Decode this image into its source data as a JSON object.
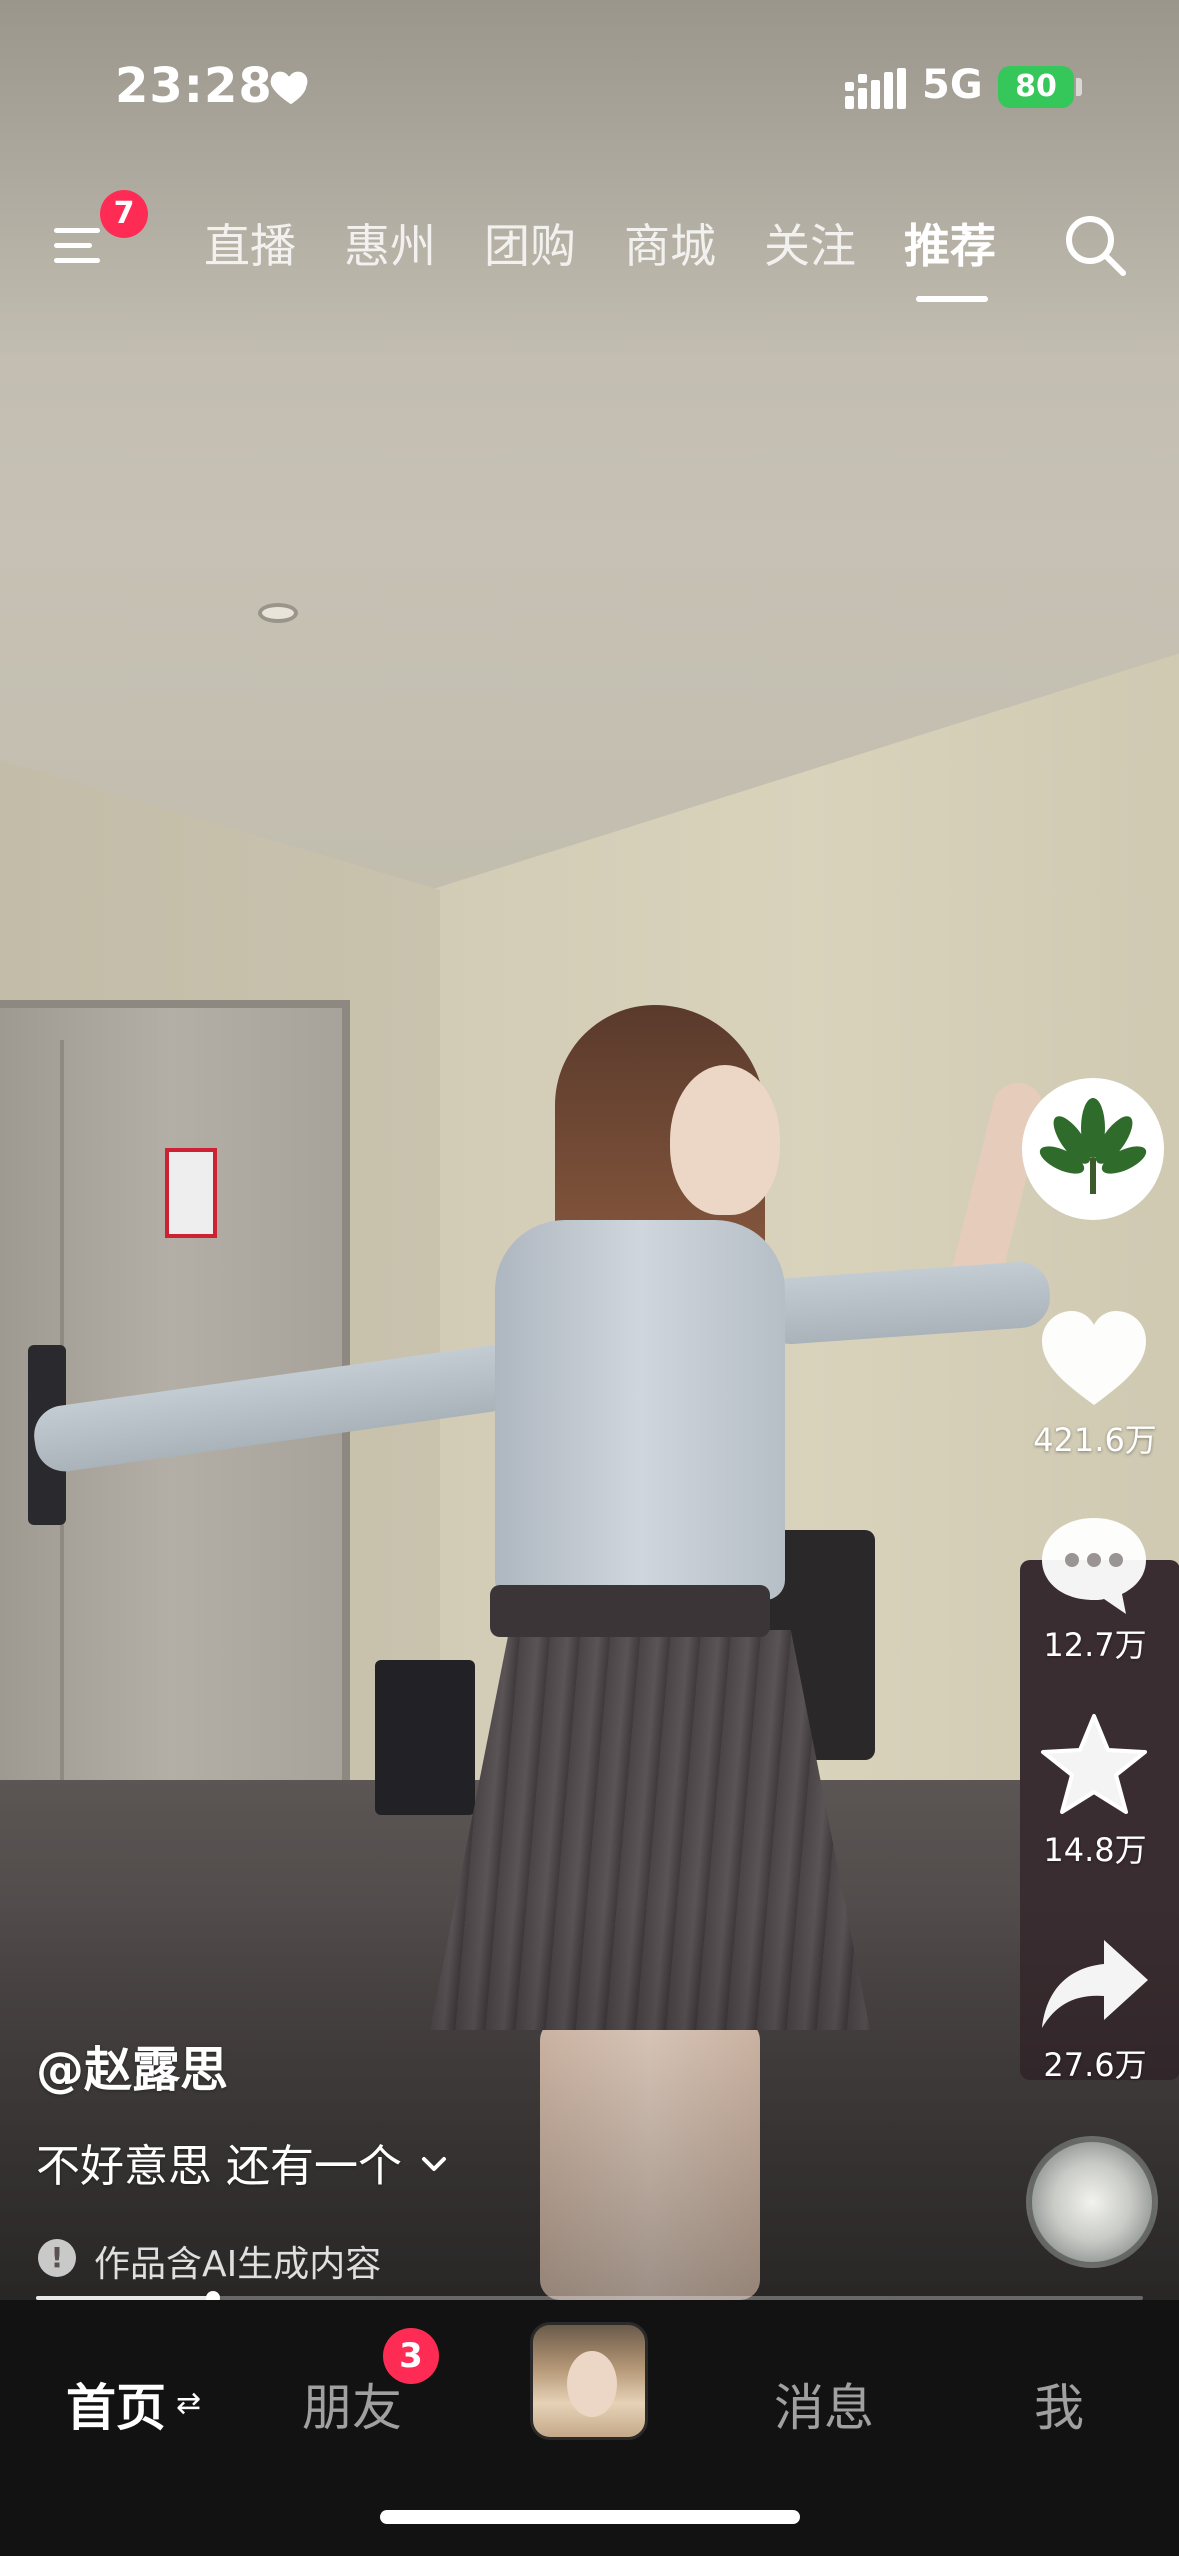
{
  "status_bar": {
    "time": "23:28",
    "network": "5G",
    "battery": "80"
  },
  "top_nav": {
    "menu_badge": "7",
    "tabs": [
      {
        "label": "直播",
        "active": false
      },
      {
        "label": "惠州",
        "active": false
      },
      {
        "label": "团购",
        "active": false
      },
      {
        "label": "商城",
        "active": false
      },
      {
        "label": "关注",
        "active": false
      },
      {
        "label": "推荐",
        "active": true
      }
    ]
  },
  "right_rail": {
    "likes": "421.6万",
    "comments": "12.7万",
    "favorites": "14.8万",
    "shares": "27.6万"
  },
  "video_info": {
    "author": "@赵露思",
    "caption": "不好意思 还有一个",
    "ai_notice": "作品含AI生成内容",
    "progress": 0.16
  },
  "bottom_tabs": {
    "home": "首页",
    "friends": "朋友",
    "friends_badge": "3",
    "messages": "消息",
    "me": "我"
  },
  "colors": {
    "badge": "#fe2c55",
    "battery": "#35c759",
    "tab_bar_bg": "#121212"
  }
}
